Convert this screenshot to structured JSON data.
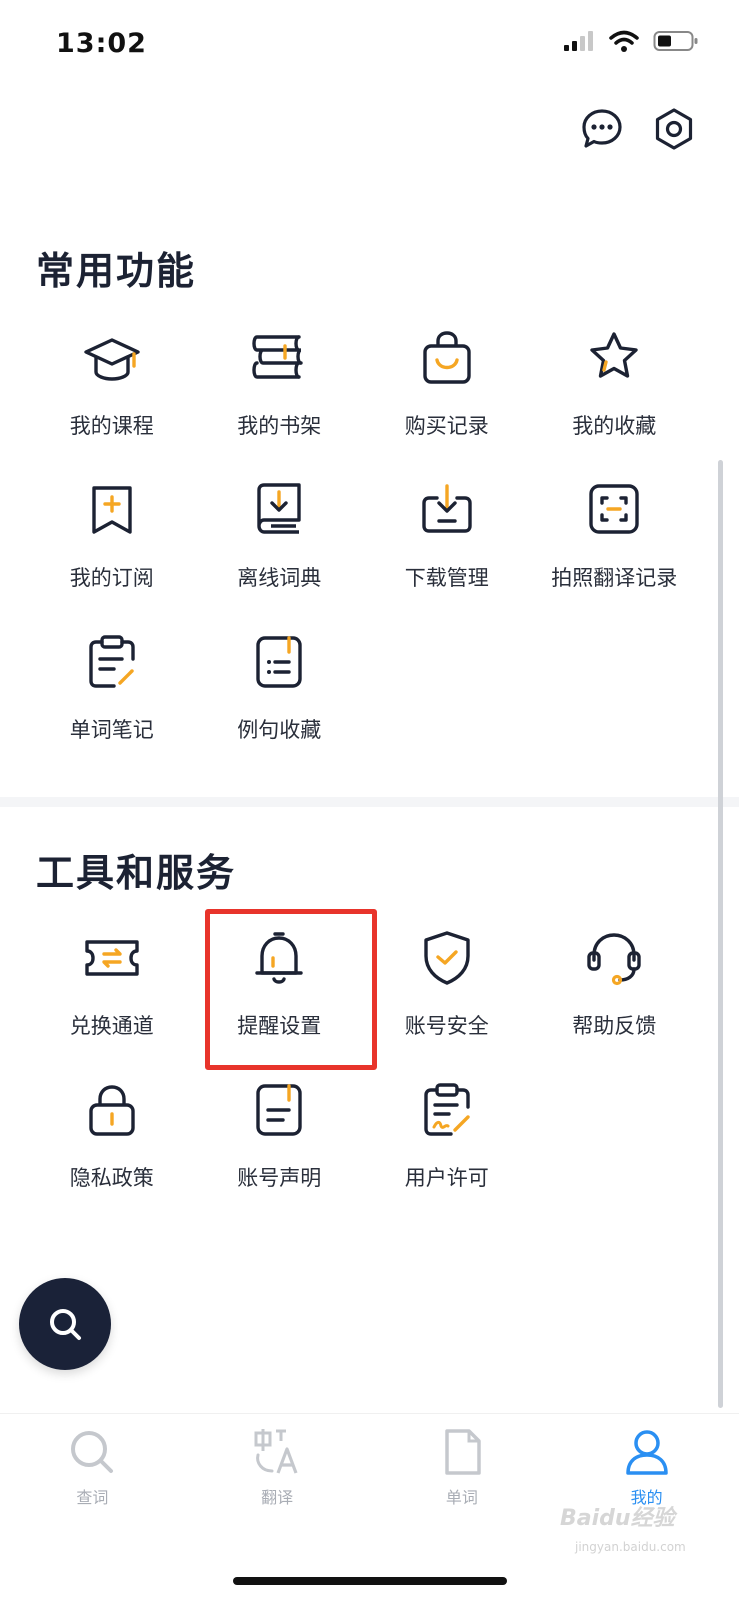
{
  "status_bar": {
    "time": "13:02"
  },
  "sections": {
    "common": {
      "title": "常用功能",
      "items": [
        {
          "label": "我的课程",
          "icon": "graduation-cap-icon"
        },
        {
          "label": "我的书架",
          "icon": "bookshelf-icon"
        },
        {
          "label": "购买记录",
          "icon": "shopping-bag-icon"
        },
        {
          "label": "我的收藏",
          "icon": "star-icon"
        },
        {
          "label": "我的订阅",
          "icon": "subscribe-bookmark-icon"
        },
        {
          "label": "离线词典",
          "icon": "offline-dictionary-icon"
        },
        {
          "label": "下载管理",
          "icon": "download-tray-icon"
        },
        {
          "label": "拍照翻译记录",
          "icon": "camera-scan-icon"
        },
        {
          "label": "单词笔记",
          "icon": "note-edit-icon"
        },
        {
          "label": "例句收藏",
          "icon": "sentence-list-icon"
        }
      ]
    },
    "tools": {
      "title": "工具和服务",
      "items": [
        {
          "label": "兑换通道",
          "icon": "ticket-exchange-icon"
        },
        {
          "label": "提醒设置",
          "icon": "bell-icon"
        },
        {
          "label": "账号安全",
          "icon": "shield-check-icon"
        },
        {
          "label": "帮助反馈",
          "icon": "headset-icon"
        },
        {
          "label": "隐私政策",
          "icon": "lock-icon"
        },
        {
          "label": "账号声明",
          "icon": "document-icon"
        },
        {
          "label": "用户许可",
          "icon": "signed-document-icon"
        }
      ]
    }
  },
  "tab_bar": {
    "items": [
      {
        "label": "查词",
        "icon": "search-icon",
        "active": false
      },
      {
        "label": "翻译",
        "icon": "translate-icon",
        "active": false
      },
      {
        "label": "单词",
        "icon": "word-card-icon",
        "active": false
      },
      {
        "label": "我的",
        "icon": "profile-icon",
        "active": true
      }
    ]
  },
  "watermark": {
    "text": "Baidu经验",
    "sub": "jingyan.baidu.com"
  },
  "colors": {
    "accent": "#f5a623",
    "dark": "#1c2233",
    "active_tab": "#2a8ff2",
    "highlight": "#e8342b"
  }
}
